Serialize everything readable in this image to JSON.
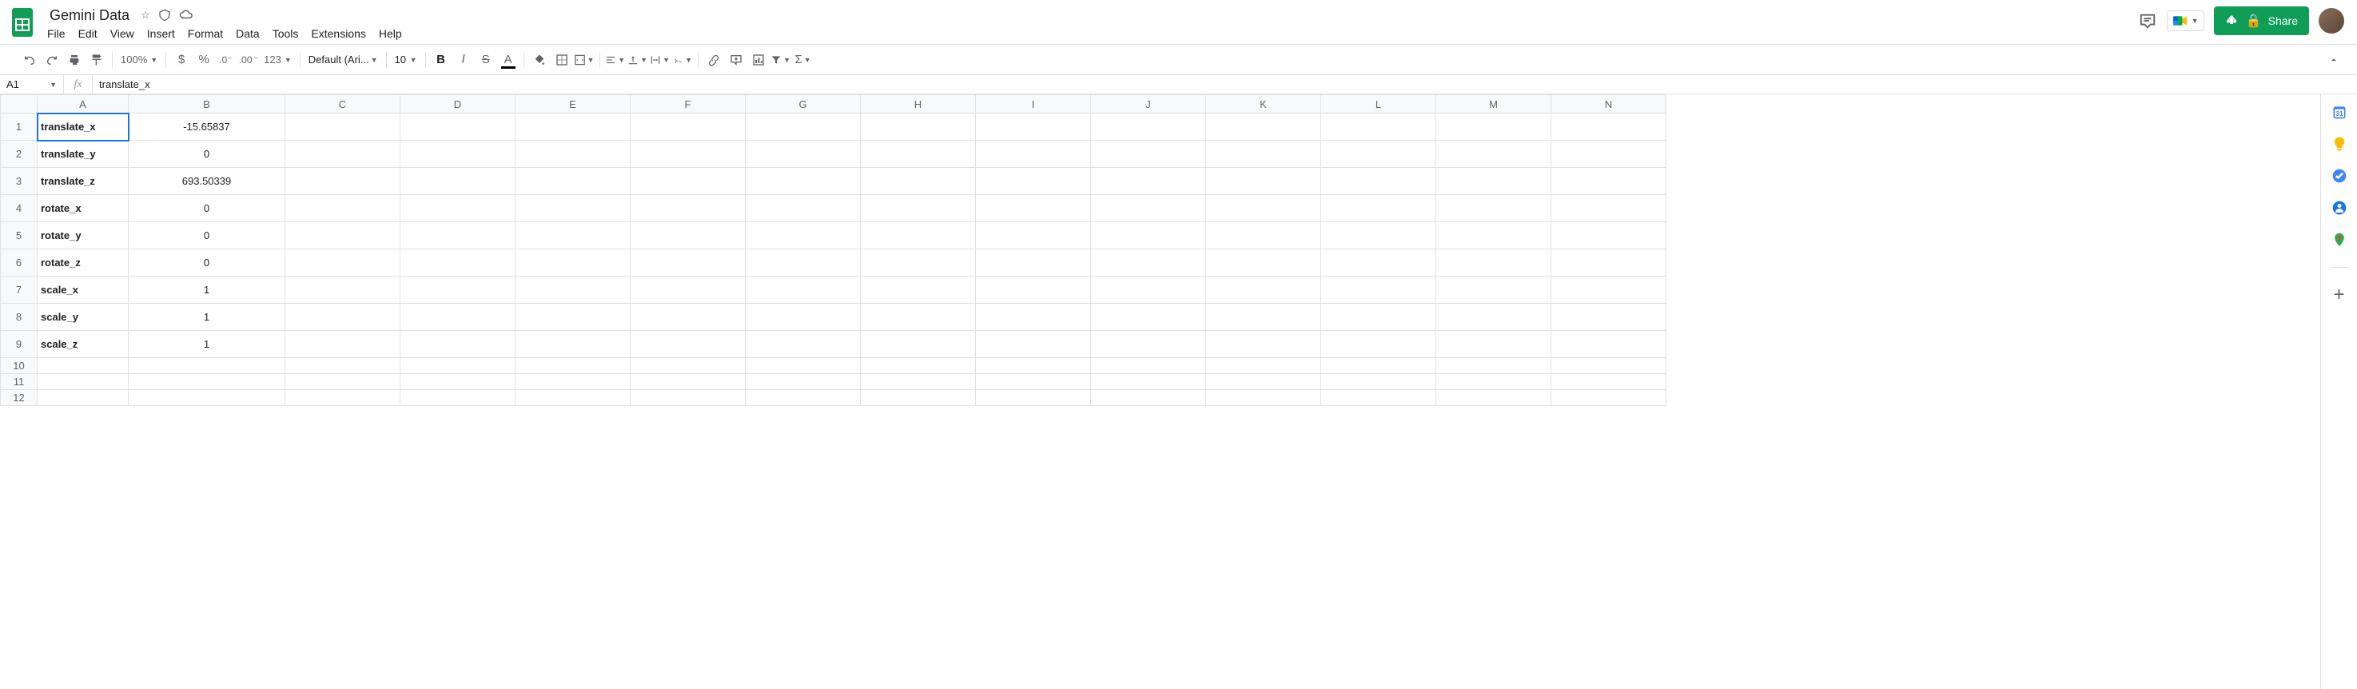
{
  "header": {
    "doc_title": "Gemini Data",
    "menus": [
      "File",
      "Edit",
      "View",
      "Insert",
      "Format",
      "Data",
      "Tools",
      "Extensions",
      "Help"
    ],
    "share_label": "Share"
  },
  "toolbar": {
    "zoom": "100%",
    "font": "Default (Ari...",
    "font_size": "10",
    "number_format": "123"
  },
  "formula_bar": {
    "cell_ref": "A1",
    "fx": "fx",
    "formula": "translate_x"
  },
  "sheet": {
    "columns": [
      "A",
      "B",
      "C",
      "D",
      "E",
      "F",
      "G",
      "H",
      "I",
      "J",
      "K",
      "L",
      "M",
      "N"
    ],
    "rows": [
      {
        "n": 1,
        "label": "translate_x",
        "value": "-15.65837",
        "tall": true
      },
      {
        "n": 2,
        "label": "translate_y",
        "value": "0",
        "tall": true
      },
      {
        "n": 3,
        "label": "translate_z",
        "value": "693.50339",
        "tall": true
      },
      {
        "n": 4,
        "label": "rotate_x",
        "value": "0",
        "tall": true
      },
      {
        "n": 5,
        "label": "rotate_y",
        "value": "0",
        "tall": true
      },
      {
        "n": 6,
        "label": "rotate_z",
        "value": "0",
        "tall": true
      },
      {
        "n": 7,
        "label": "scale_x",
        "value": "1",
        "tall": true
      },
      {
        "n": 8,
        "label": "scale_y",
        "value": "1",
        "tall": true
      },
      {
        "n": 9,
        "label": "scale_z",
        "value": "1",
        "tall": true
      },
      {
        "n": 10,
        "label": "",
        "value": "",
        "tall": false
      },
      {
        "n": 11,
        "label": "",
        "value": "",
        "tall": false
      },
      {
        "n": 12,
        "label": "",
        "value": "",
        "tall": false
      }
    ],
    "selected_cell": "A1"
  },
  "side_panel": {
    "icons": [
      "calendar",
      "keep",
      "tasks",
      "contacts",
      "maps",
      "add"
    ]
  }
}
